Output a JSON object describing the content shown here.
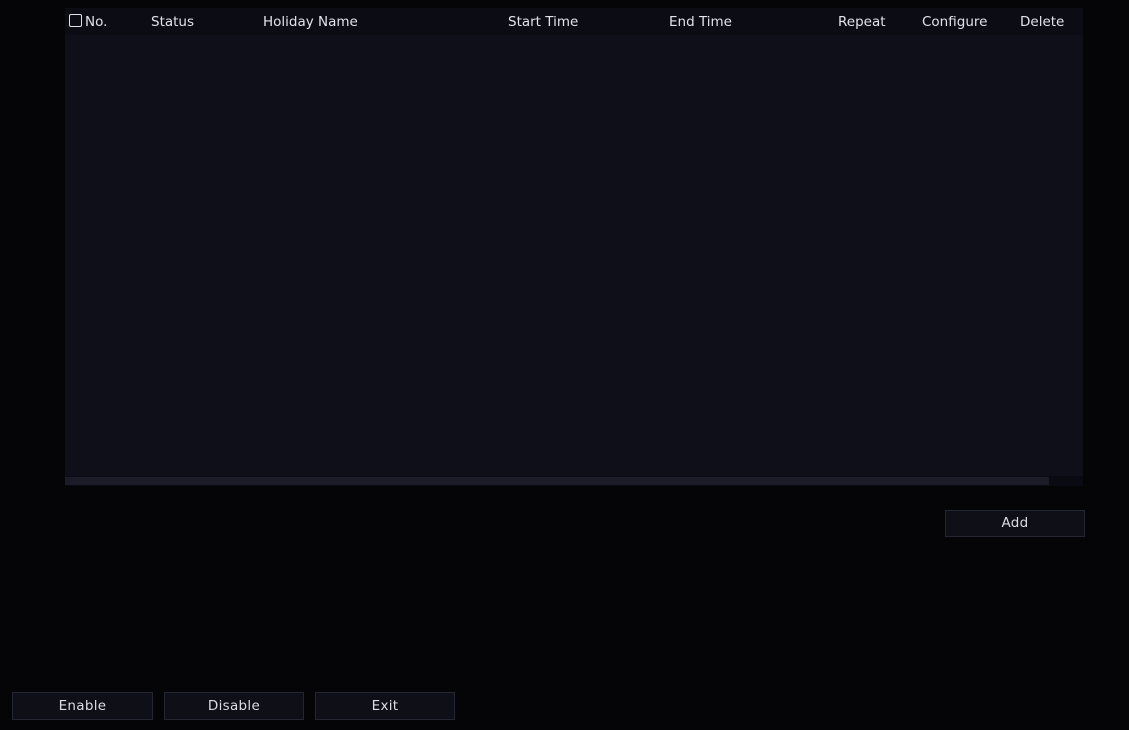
{
  "table": {
    "columns": {
      "no": "No.",
      "status": "Status",
      "holiday_name": "Holiday Name",
      "start_time": "Start Time",
      "end_time": "End Time",
      "repeat": "Repeat",
      "configure": "Configure",
      "delete": "Delete"
    },
    "rows": [],
    "select_all_checked": false
  },
  "actions": {
    "add_label": "Add"
  },
  "footer": {
    "enable_label": "Enable",
    "disable_label": "Disable",
    "exit_label": "Exit"
  }
}
